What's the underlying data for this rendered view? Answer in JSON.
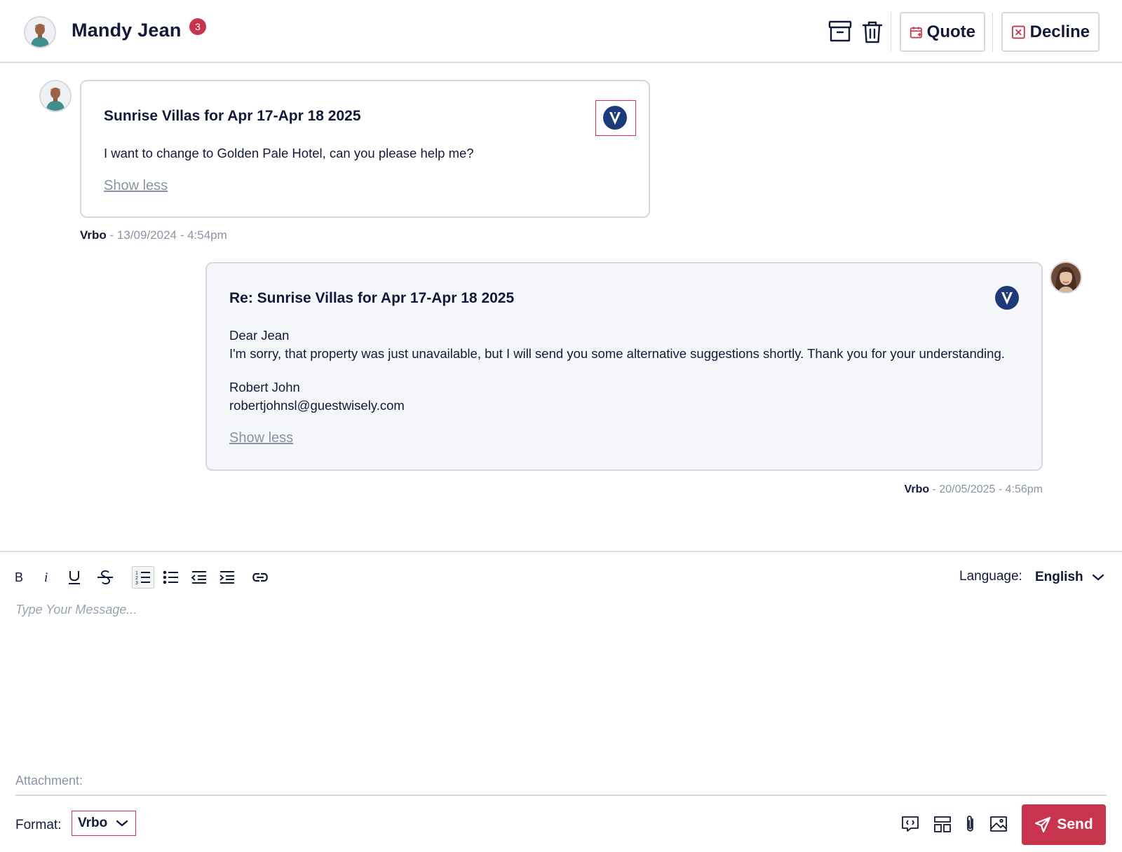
{
  "header": {
    "contact_name": "Mandy Jean",
    "notification_count": "3",
    "quote_label": "Quote",
    "decline_label": "Decline"
  },
  "messages": [
    {
      "title": "Sunrise Villas for Apr 17-Apr 18 2025",
      "body": "I want to change to Golden Pale Hotel, can you please help me?",
      "toggle": "Show less",
      "channel": "Vrbo",
      "timestamp": " - 13/09/2024 - 4:54pm"
    },
    {
      "title": "Re: Sunrise Villas for Apr 17-Apr 18 2025",
      "greeting": "Dear Jean",
      "body": "I'm sorry, that property was just unavailable, but I will send you some alternative suggestions shortly. Thank you for your understanding.",
      "signature_name": "Robert John",
      "signature_email": "robertjohnsl@guestwisely.com",
      "toggle": "Show less",
      "channel": "Vrbo",
      "timestamp": " - 20/05/2025 - 4:56pm"
    }
  ],
  "composer": {
    "language_label": "Language:",
    "language_value": "English",
    "placeholder": "Type Your Message...",
    "attachment_label": "Attachment:",
    "format_label": "Format:",
    "format_value": "Vrbo",
    "send_label": "Send"
  },
  "colors": {
    "accent": "#c8334e",
    "text": "#14183a",
    "muted": "#8a93a6",
    "vrbo_blue": "#1d3b7a"
  }
}
